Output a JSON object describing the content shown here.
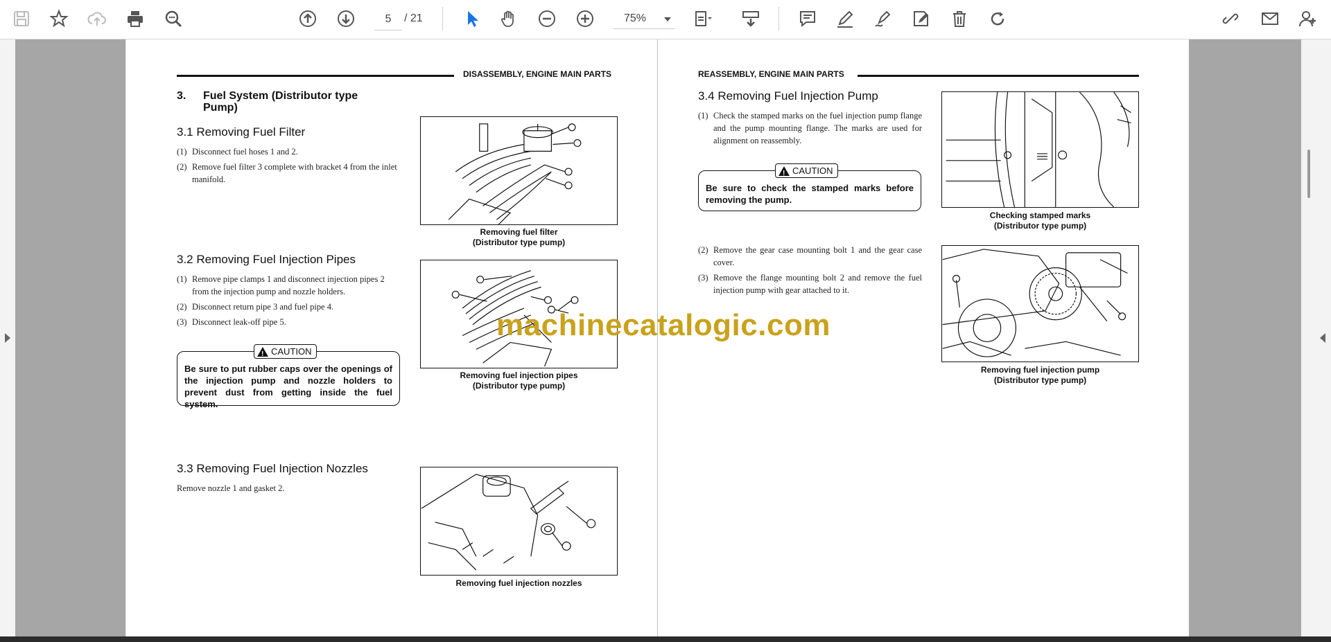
{
  "toolbar": {
    "page_current": "5",
    "page_total": "/ 21",
    "zoom": "75%"
  },
  "left_page": {
    "header": "DISASSEMBLY, ENGINE MAIN PARTS",
    "section_num": "3.",
    "section_title_1": "Fuel System (Distributor type",
    "section_title_2": "Pump)",
    "s31_title": "3.1   Removing Fuel Filter",
    "s31_items": [
      {
        "n": "(1)",
        "t": "Disconnect fuel hoses 1 and 2."
      },
      {
        "n": "(2)",
        "t": "Remove fuel filter 3 complete with bracket 4 from the inlet manifold."
      }
    ],
    "fig1_caption_1": "Removing fuel filter",
    "fig1_caption_2": "(Distributor type pump)",
    "s32_title": "3.2   Removing Fuel Injection Pipes",
    "s32_items": [
      {
        "n": "(1)",
        "t": "Remove pipe clamps 1 and disconnect injection pipes 2 from the injection pump and nozzle holders."
      },
      {
        "n": "(2)",
        "t": "Disconnect return pipe 3 and fuel pipe 4."
      },
      {
        "n": "(3)",
        "t": "Disconnect leak-off pipe 5."
      }
    ],
    "caution_label": "CAUTION",
    "caution_text": "Be sure to put rubber caps over the openings of the injection pump and nozzle holders to prevent dust from getting inside the fuel system.",
    "fig2_caption_1": "Removing fuel injection pipes",
    "fig2_caption_2": "(Distributor type pump)",
    "s33_title": "3.3   Removing Fuel Injection Nozzles",
    "s33_text": "Remove nozzle 1 and gasket 2.",
    "fig3_caption_1": "Removing fuel injection nozzles"
  },
  "right_page": {
    "header": "REASSEMBLY, ENGINE MAIN PARTS",
    "s34_title": "3.4   Removing Fuel Injection Pump",
    "s34_items_a": [
      {
        "n": "(1)",
        "t": "Check the stamped marks on the fuel injection pump flange and the pump mounting flange. The marks are used for alignment on reassembly."
      }
    ],
    "caution_label": "CAUTION",
    "caution_text": "Be sure to check the stamped marks before removing the pump.",
    "fig4_caption_1": "Checking stamped marks",
    "fig4_caption_2": "(Distributor type pump)",
    "s34_items_b": [
      {
        "n": "(2)",
        "t": "Remove the gear case mounting bolt 1 and the gear case cover."
      },
      {
        "n": "(3)",
        "t": "Remove the flange mounting bolt 2 and remove the fuel injection pump with gear attached to it."
      }
    ],
    "fig5_caption_1": "Removing fuel injection pump",
    "fig5_caption_2": "(Distributor type pump)"
  },
  "watermark": "machinecatalogic.com",
  "colors": {
    "accent": "#1a73e8",
    "watermark": "#c9a21c",
    "gray_bg": "#a6a6a6"
  }
}
